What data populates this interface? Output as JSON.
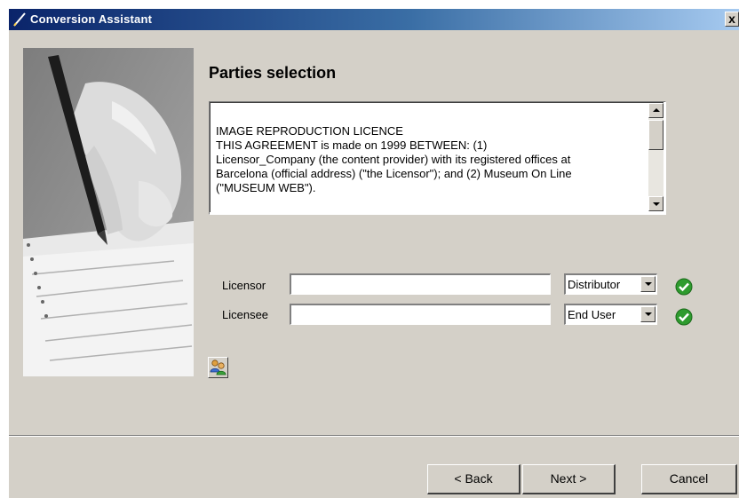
{
  "window": {
    "title": "Conversion Assistant",
    "close_label": "x"
  },
  "page": {
    "heading": "Parties selection"
  },
  "license": {
    "text": "IMAGE REPRODUCTION LICENCE\nTHIS AGREEMENT is made on 1999 BETWEEN: (1)\nLicensor_Company (the content provider) with its registered offices at\nBarcelona (official address) (\"the Licensor\"); and (2) Museum On Line\n(\"MUSEUM WEB\")."
  },
  "form": {
    "licensor": {
      "label": "Licensor",
      "value": "",
      "role": "Distributor"
    },
    "licensee": {
      "label": "Licensee",
      "value": "",
      "role": "End User"
    }
  },
  "buttons": {
    "back": "< Back",
    "next": "Next >",
    "cancel": "Cancel"
  },
  "colors": {
    "dialog_bg": "#d4d0c8",
    "title_start": "#0a246a",
    "title_end": "#a6caf0",
    "ok_green": "#2e9b2e"
  },
  "icons": {
    "title": "pen-icon",
    "licensor_status": "check-circle-icon",
    "licensee_status": "check-circle-icon",
    "parties": "people-icon"
  }
}
